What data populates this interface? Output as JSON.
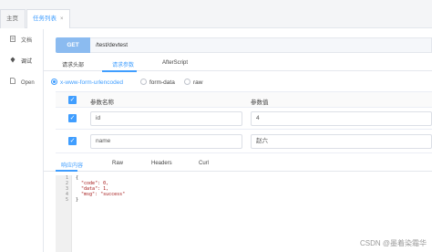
{
  "tabs": [
    {
      "label": "主页",
      "closable": false
    },
    {
      "label": "任务列表",
      "closable": true,
      "close_glyph": "×"
    }
  ],
  "sidebar": {
    "items": [
      {
        "label": "文档",
        "icon": "document-icon"
      },
      {
        "label": "调试",
        "icon": "debug-icon",
        "active": true
      },
      {
        "label": "Open",
        "icon": "open-file-icon"
      }
    ]
  },
  "request": {
    "method": "GET",
    "url": "/test/devtest"
  },
  "request_tabs": {
    "items": [
      "请求头部",
      "请求参数",
      "AfterScript"
    ],
    "active": "请求参数"
  },
  "body_types": {
    "options": [
      "x-www-form-urlencoded",
      "form-data",
      "raw"
    ],
    "selected": "x-www-form-urlencoded"
  },
  "params_table": {
    "headers": {
      "name": "参数名称",
      "value": "参数值"
    },
    "rows": [
      {
        "name": "id",
        "value": "4",
        "checked": true
      },
      {
        "name": "name",
        "value": "赵六",
        "checked": true
      }
    ]
  },
  "response_tabs": {
    "items": [
      "响应内容",
      "Raw",
      "Headers",
      "Curl"
    ],
    "active": "响应内容"
  },
  "response": {
    "line_numbers": [
      "1",
      "2",
      "3",
      "4",
      "5"
    ],
    "lines": [
      "{",
      "  \"code\": 0,",
      "  \"data\": 1,",
      "  \"msg\": \"success\"",
      "}"
    ]
  },
  "watermark": "CSDN @墨着染霜华",
  "colors": {
    "accent": "#409eff",
    "method_bg": "#8bbbf0"
  }
}
